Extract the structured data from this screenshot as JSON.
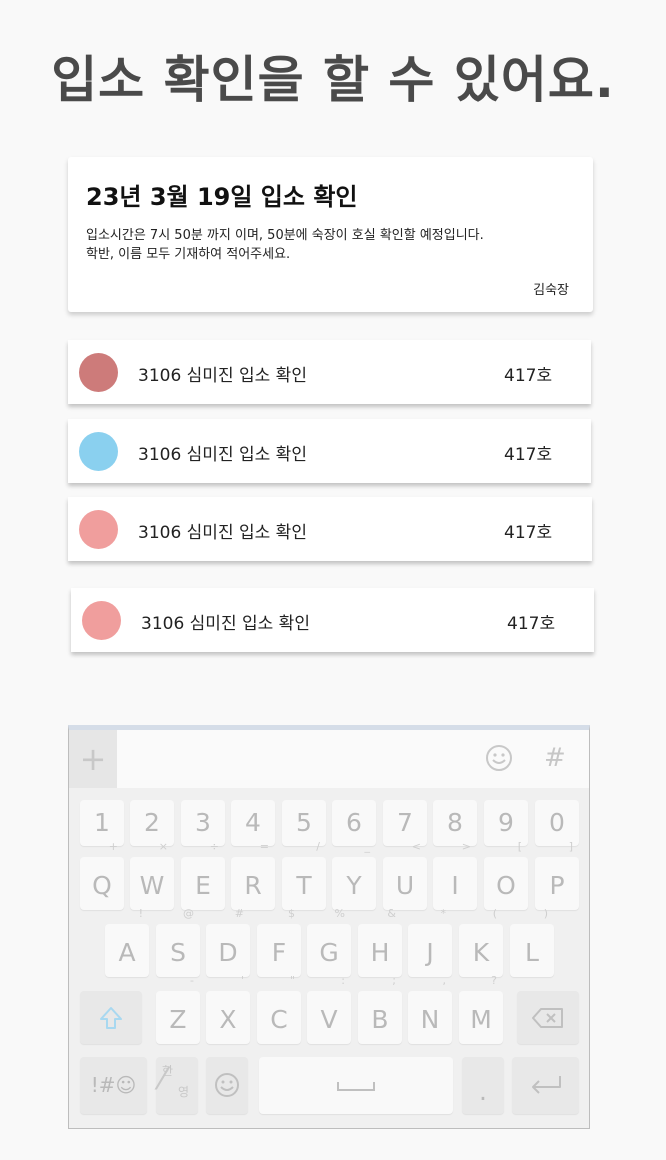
{
  "headline": "입소 확인을 할 수 있어요.",
  "notice": {
    "title": "23년 3월 19일 입소 확인",
    "body_line1": "입소시간은 7시 50분 까지 이며, 50분에 숙장이 호실 확인할 예정입니다.",
    "body_line2": "학반, 이름 모두 기재하여 적어주세요.",
    "author": "김숙장"
  },
  "entries": [
    {
      "name": "3106 심미진 입소 확인",
      "room": "417호",
      "color": "#cd7b7a"
    },
    {
      "name": "3106 심미진 입소 확인",
      "room": "417호",
      "color": "#8ad0ef"
    },
    {
      "name": "3106 심미진 입소 확인",
      "room": "417호",
      "color": "#f09e9d"
    },
    {
      "name": "3106 심미진 입소 확인",
      "room": "417호",
      "color": "#f09e9d"
    }
  ],
  "keyboard": {
    "plus": "+",
    "hash": "#",
    "numbers": [
      "1",
      "2",
      "3",
      "4",
      "5",
      "6",
      "7",
      "8",
      "9",
      "0"
    ],
    "row1": [
      {
        "key": "Q",
        "sub": "+"
      },
      {
        "key": "W",
        "sub": "×"
      },
      {
        "key": "E",
        "sub": "÷"
      },
      {
        "key": "R",
        "sub": "="
      },
      {
        "key": "T",
        "sub": "/"
      },
      {
        "key": "Y",
        "sub": "_"
      },
      {
        "key": "U",
        "sub": "<"
      },
      {
        "key": "I",
        "sub": ">"
      },
      {
        "key": "O",
        "sub": "["
      },
      {
        "key": "P",
        "sub": "]"
      }
    ],
    "row2": [
      {
        "key": "A",
        "sub": "!"
      },
      {
        "key": "S",
        "sub": "@"
      },
      {
        "key": "D",
        "sub": "#"
      },
      {
        "key": "F",
        "sub": "$"
      },
      {
        "key": "G",
        "sub": "%"
      },
      {
        "key": "H",
        "sub": "&"
      },
      {
        "key": "J",
        "sub": "*"
      },
      {
        "key": "K",
        "sub": "("
      },
      {
        "key": "L",
        "sub": ")"
      }
    ],
    "row3": [
      {
        "key": "Z",
        "sub": "-"
      },
      {
        "key": "X",
        "sub": "'"
      },
      {
        "key": "C",
        "sub": "\""
      },
      {
        "key": "V",
        "sub": ":"
      },
      {
        "key": "B",
        "sub": ";"
      },
      {
        "key": "N",
        "sub": ","
      },
      {
        "key": "M",
        "sub": "?"
      }
    ],
    "symbols_label": "!#☺",
    "lang_top": "한",
    "lang_bottom": "영",
    "period": "."
  },
  "colors": {
    "headline": "#4a4a4a",
    "keyboard_bg": "#f0f0f0",
    "keyboard_border_top": "#d5dde8",
    "shift": "#a8d8f0"
  }
}
